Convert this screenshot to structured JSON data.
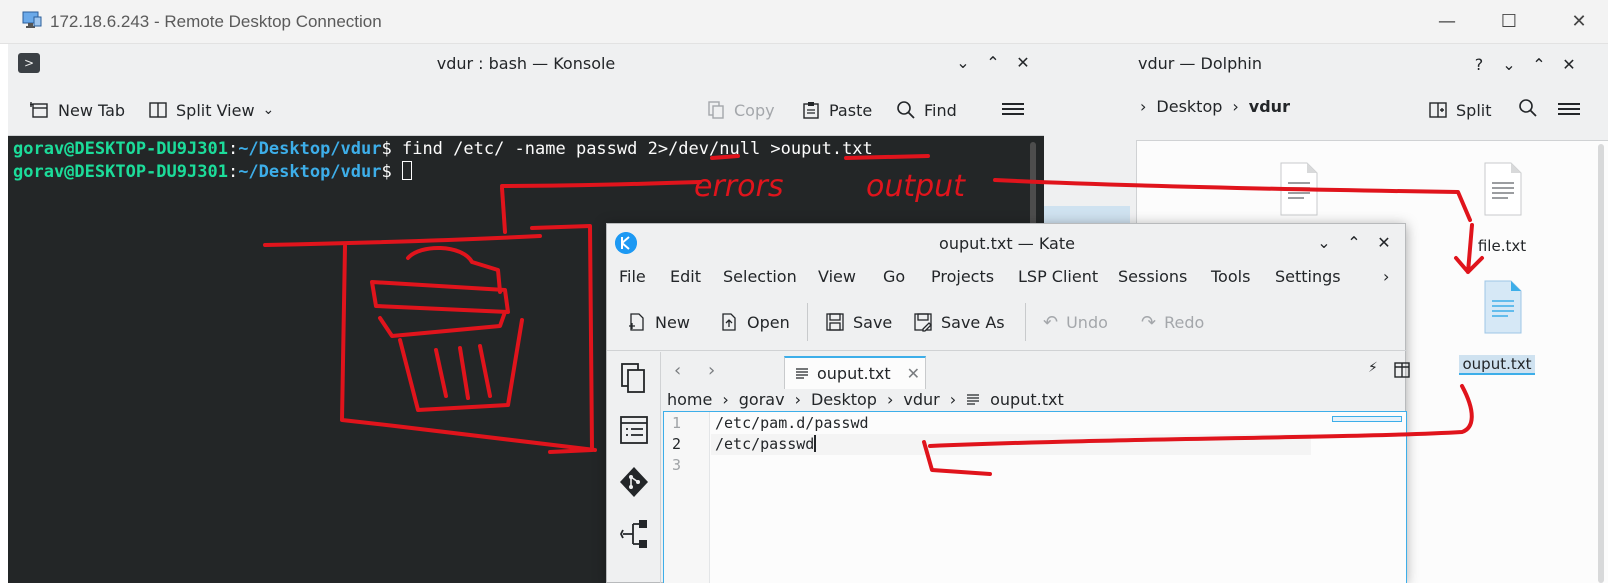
{
  "rdp": {
    "title": "172.18.6.243 - Remote Desktop Connection",
    "minimize": "—",
    "maximize": "☐",
    "close": "✕"
  },
  "konsole": {
    "title": "vdur : bash — Konsole",
    "toolbar": {
      "new_tab": "New Tab",
      "split_view": "Split View",
      "copy": "Copy",
      "paste": "Paste",
      "find": "Find"
    },
    "lines": [
      {
        "user": "gorav@DESKTOP-DU9J301",
        "sep": ":",
        "path": "~/Desktop/vdur",
        "prompt": "$ ",
        "command": "find /etc/ -name passwd 2>/dev/null >ouput.txt"
      },
      {
        "user": "gorav@DESKTOP-DU9J301",
        "sep": ":",
        "path": "~/Desktop/vdur",
        "prompt": "$ ",
        "command": ""
      }
    ]
  },
  "dolphin": {
    "title": "vdur — Dolphin",
    "help": "?",
    "breadcrumb": [
      "Desktop",
      "vdur"
    ],
    "split_label": "Split",
    "files": [
      {
        "name": ""
      },
      {
        "name": "file.txt"
      },
      {
        "name": "ouput.txt",
        "selected": true
      }
    ]
  },
  "kate": {
    "title": "ouput.txt — Kate",
    "menu": [
      "File",
      "Edit",
      "Selection",
      "View",
      "Go",
      "Projects",
      "LSP Client",
      "Sessions",
      "Tools",
      "Settings"
    ],
    "toolbar": {
      "new": "New",
      "open": "Open",
      "save": "Save",
      "save_as": "Save As",
      "undo": "Undo",
      "redo": "Redo"
    },
    "tab": {
      "label": "ouput.txt"
    },
    "breadcrumb": [
      "home",
      "gorav",
      "Desktop",
      "vdur",
      "ouput.txt"
    ],
    "line_numbers": [
      "1",
      "2",
      "3"
    ],
    "lines": [
      "/etc/pam.d/passwd",
      "/etc/passwd",
      ""
    ]
  },
  "annotations": {
    "errors_label": "errors",
    "output_label": "output",
    "color": "#e0141c"
  }
}
